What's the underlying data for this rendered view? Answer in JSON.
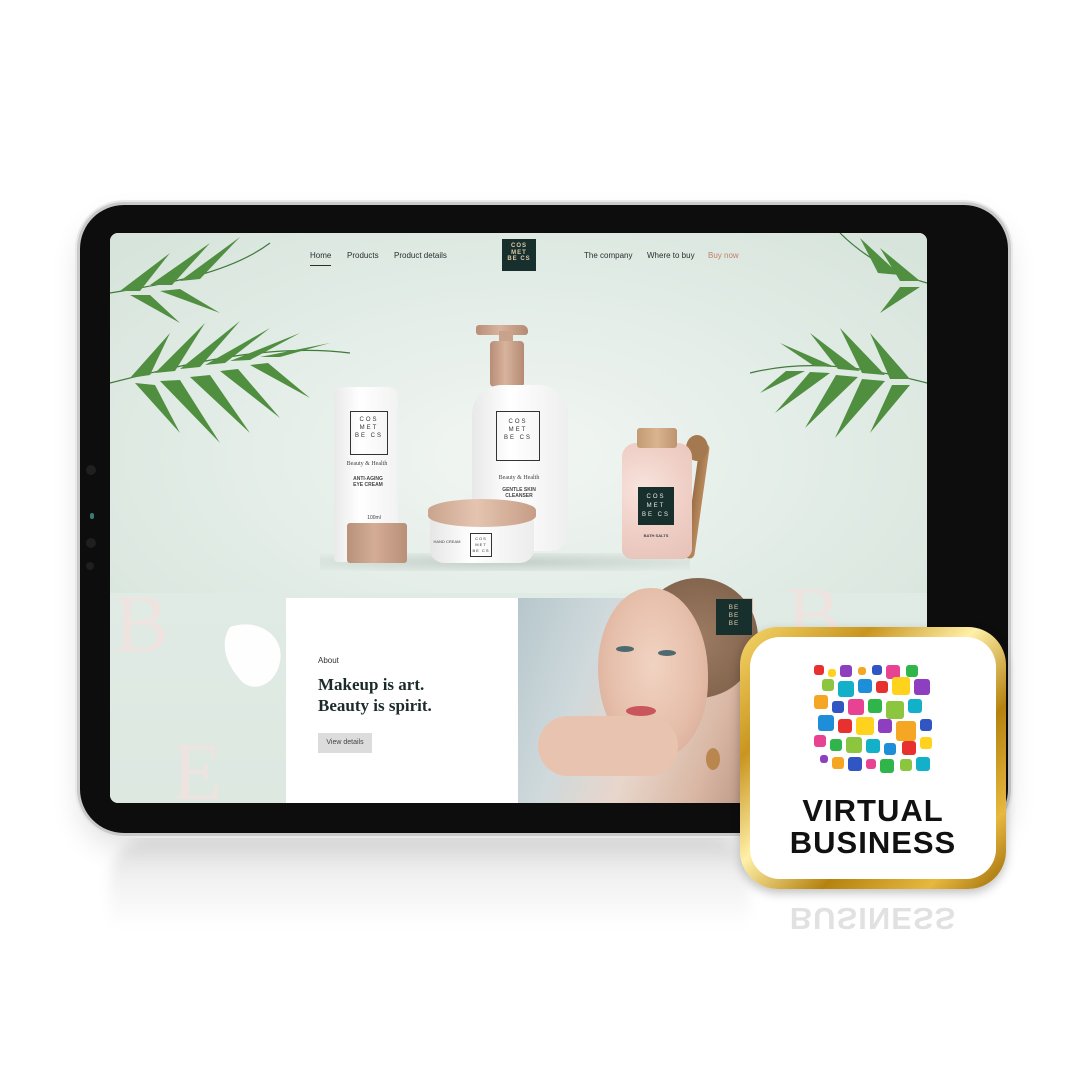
{
  "nav": {
    "left": [
      "Home",
      "Products",
      "Product details"
    ],
    "right": [
      "The company",
      "Where to buy",
      "Buy now"
    ],
    "logo_lines": [
      "COS",
      "MET",
      "BE CS"
    ]
  },
  "hero": {
    "decor_letters": [
      "B",
      "E",
      "B"
    ],
    "tube": {
      "brand": [
        "COS",
        "MET",
        "BE CS"
      ],
      "subtitle": "Beauty & Health",
      "product": "ANTI-AGING EYE CREAM",
      "size": "100ml"
    },
    "bottle": {
      "brand": [
        "COS",
        "MET",
        "BE CS"
      ],
      "subtitle": "Beauty & Health",
      "product": "GENTLE SKIN CLEANSER"
    },
    "jar": {
      "brand": [
        "COS",
        "MET",
        "BE CS"
      ],
      "product": "HAND CREAM"
    },
    "salt": {
      "brand": [
        "COS",
        "MET",
        "BE CS"
      ],
      "product": "BATH SALTS"
    }
  },
  "about": {
    "label": "About",
    "title_line1": "Makeup is art.",
    "title_line2": "Beauty is spirit.",
    "button": "View details",
    "corner_mark": [
      "BE",
      "BE",
      "BE"
    ]
  },
  "badge": {
    "line1": "VIRTUAL",
    "line2": "BUSINESS",
    "colors": [
      "#e8302f",
      "#f5a623",
      "#2fb54a",
      "#1f8ed8",
      "#8e3fbf",
      "#e84393",
      "#12b0c9",
      "#ffd21e",
      "#3156c4",
      "#8cc63f"
    ]
  }
}
